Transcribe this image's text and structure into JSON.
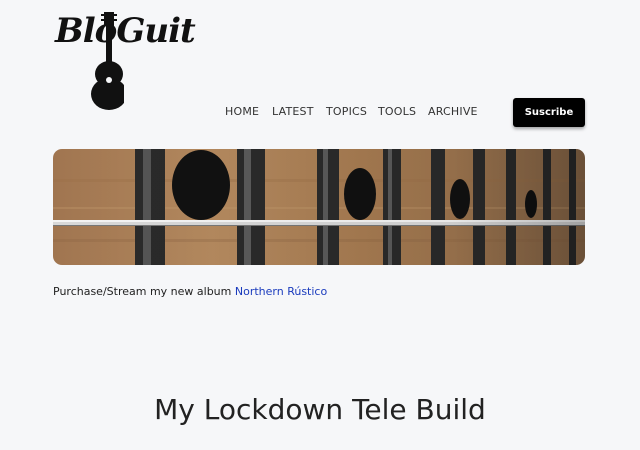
{
  "site": {
    "logo_text": "BloGuit"
  },
  "nav": {
    "items": [
      {
        "label": "HOME"
      },
      {
        "label": "LATEST"
      },
      {
        "label": "TOPICS"
      },
      {
        "label": "TOOLS"
      },
      {
        "label": "ARCHIVE"
      }
    ],
    "subscribe_label": "Suscribe"
  },
  "hero": {
    "image": "guitar-fretboard-closeup"
  },
  "album": {
    "prefix": "Purchase/Stream my new album",
    "link_text": "Northern Rústico",
    "link_color": "#1a3bbd"
  },
  "post": {
    "title": "My Lockdown Tele Build"
  }
}
